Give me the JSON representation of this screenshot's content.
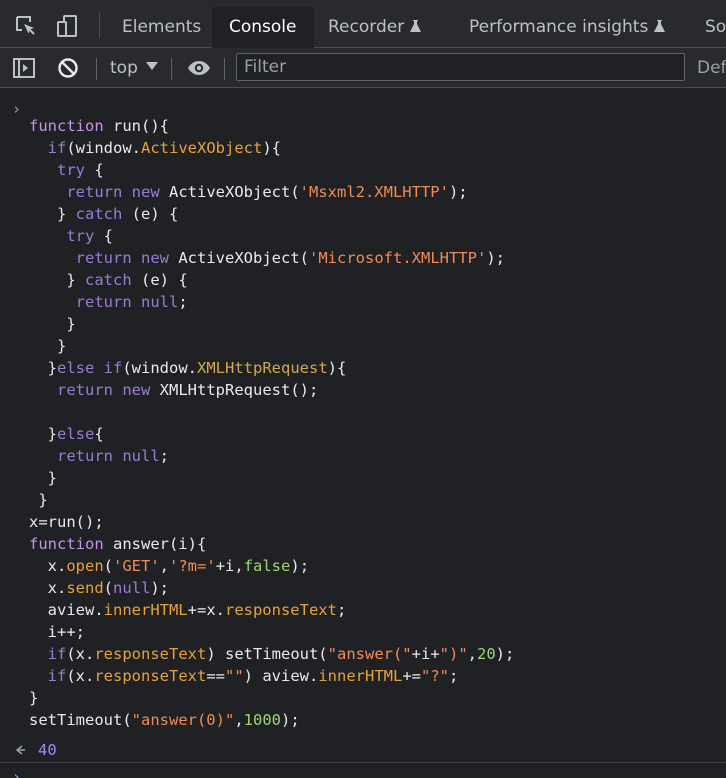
{
  "tabs": [
    {
      "label": "Elements",
      "active": false,
      "experimental": false
    },
    {
      "label": "Console",
      "active": true,
      "experimental": false
    },
    {
      "label": "Recorder",
      "active": false,
      "experimental": true
    },
    {
      "label": "Performance insights",
      "active": false,
      "experimental": true
    },
    {
      "label": "So",
      "active": false,
      "experimental": false
    }
  ],
  "toolbar": {
    "context_label": "top",
    "filter_placeholder": "Filter",
    "levels_label": "Def"
  },
  "icons": {
    "inspect": "inspect-element-icon",
    "device": "device-toolbar-icon",
    "sidebar": "show-sidebar-icon",
    "clear": "clear-console-icon",
    "eye": "live-expression-eye-icon",
    "flask": "experimental-flask-icon"
  },
  "console": {
    "code_lines": [
      [
        {
          "t": "function",
          "c": "k"
        },
        {
          "t": " run(){",
          "c": ""
        }
      ],
      [
        {
          "t": "  ",
          "c": ""
        },
        {
          "t": "if",
          "c": "kw"
        },
        {
          "t": "(window.",
          "c": ""
        },
        {
          "t": "ActiveXObject",
          "c": "p"
        },
        {
          "t": "){",
          "c": ""
        }
      ],
      [
        {
          "t": "   ",
          "c": ""
        },
        {
          "t": "try",
          "c": "kw"
        },
        {
          "t": " {",
          "c": ""
        }
      ],
      [
        {
          "t": "    ",
          "c": ""
        },
        {
          "t": "return",
          "c": "kw"
        },
        {
          "t": " ",
          "c": ""
        },
        {
          "t": "new",
          "c": "kw"
        },
        {
          "t": " ActiveXObject(",
          "c": ""
        },
        {
          "t": "'Msxml2.XMLHTTP'",
          "c": "s"
        },
        {
          "t": ");",
          "c": ""
        }
      ],
      [
        {
          "t": "   } ",
          "c": ""
        },
        {
          "t": "catch",
          "c": "kw"
        },
        {
          "t": " (e) {",
          "c": ""
        }
      ],
      [
        {
          "t": "    ",
          "c": ""
        },
        {
          "t": "try",
          "c": "kw"
        },
        {
          "t": " {",
          "c": ""
        }
      ],
      [
        {
          "t": "     ",
          "c": ""
        },
        {
          "t": "return",
          "c": "kw"
        },
        {
          "t": " ",
          "c": ""
        },
        {
          "t": "new",
          "c": "kw"
        },
        {
          "t": " ActiveXObject(",
          "c": ""
        },
        {
          "t": "'Microsoft.XMLHTTP'",
          "c": "s"
        },
        {
          "t": ");",
          "c": ""
        }
      ],
      [
        {
          "t": "    } ",
          "c": ""
        },
        {
          "t": "catch",
          "c": "kw"
        },
        {
          "t": " (e) {",
          "c": ""
        }
      ],
      [
        {
          "t": "     ",
          "c": ""
        },
        {
          "t": "return",
          "c": "kw"
        },
        {
          "t": " ",
          "c": ""
        },
        {
          "t": "null",
          "c": "kw"
        },
        {
          "t": ";",
          "c": ""
        }
      ],
      [
        {
          "t": "    }",
          "c": ""
        }
      ],
      [
        {
          "t": "   }",
          "c": ""
        }
      ],
      [
        {
          "t": "  }",
          "c": ""
        },
        {
          "t": "else",
          "c": "kw"
        },
        {
          "t": " ",
          "c": ""
        },
        {
          "t": "if",
          "c": "kw"
        },
        {
          "t": "(window.",
          "c": ""
        },
        {
          "t": "XMLHttpRequest",
          "c": "fn"
        },
        {
          "t": "){",
          "c": ""
        }
      ],
      [
        {
          "t": "   ",
          "c": ""
        },
        {
          "t": "return",
          "c": "kw"
        },
        {
          "t": " ",
          "c": ""
        },
        {
          "t": "new",
          "c": "kw"
        },
        {
          "t": " XMLHttpRequest();",
          "c": ""
        }
      ],
      [
        {
          "t": "",
          "c": ""
        }
      ],
      [
        {
          "t": "  }",
          "c": ""
        },
        {
          "t": "else",
          "c": "kw"
        },
        {
          "t": "{",
          "c": ""
        }
      ],
      [
        {
          "t": "   ",
          "c": ""
        },
        {
          "t": "return",
          "c": "kw"
        },
        {
          "t": " ",
          "c": ""
        },
        {
          "t": "null",
          "c": "kw"
        },
        {
          "t": ";",
          "c": ""
        }
      ],
      [
        {
          "t": "  }",
          "c": ""
        }
      ],
      [
        {
          "t": " }",
          "c": ""
        }
      ],
      [
        {
          "t": "x=run();",
          "c": ""
        }
      ],
      [
        {
          "t": "function",
          "c": "k"
        },
        {
          "t": " answer(i){",
          "c": ""
        }
      ],
      [
        {
          "t": "  x.",
          "c": ""
        },
        {
          "t": "open",
          "c": "p"
        },
        {
          "t": "(",
          "c": ""
        },
        {
          "t": "'GET'",
          "c": "s"
        },
        {
          "t": ",",
          "c": ""
        },
        {
          "t": "'?m='",
          "c": "s"
        },
        {
          "t": "+i,",
          "c": ""
        },
        {
          "t": "false",
          "c": "n"
        },
        {
          "t": ");",
          "c": ""
        }
      ],
      [
        {
          "t": "  x.",
          "c": ""
        },
        {
          "t": "send",
          "c": "p"
        },
        {
          "t": "(",
          "c": ""
        },
        {
          "t": "null",
          "c": "kw"
        },
        {
          "t": ");",
          "c": ""
        }
      ],
      [
        {
          "t": "  aview.",
          "c": ""
        },
        {
          "t": "innerHTML",
          "c": "p"
        },
        {
          "t": "+=x.",
          "c": ""
        },
        {
          "t": "responseText",
          "c": "p"
        },
        {
          "t": ";",
          "c": ""
        }
      ],
      [
        {
          "t": "  i++;",
          "c": ""
        }
      ],
      [
        {
          "t": "  ",
          "c": ""
        },
        {
          "t": "if",
          "c": "kw"
        },
        {
          "t": "(x.",
          "c": ""
        },
        {
          "t": "responseText",
          "c": "p"
        },
        {
          "t": ") setTimeout(",
          "c": ""
        },
        {
          "t": "\"answer(\"",
          "c": "s"
        },
        {
          "t": "+i+",
          "c": ""
        },
        {
          "t": "\")\"",
          "c": "s"
        },
        {
          "t": ",",
          "c": ""
        },
        {
          "t": "20",
          "c": "n"
        },
        {
          "t": ");",
          "c": ""
        }
      ],
      [
        {
          "t": "  ",
          "c": ""
        },
        {
          "t": "if",
          "c": "kw"
        },
        {
          "t": "(x.",
          "c": ""
        },
        {
          "t": "responseText",
          "c": "p"
        },
        {
          "t": "==",
          "c": ""
        },
        {
          "t": "\"\"",
          "c": "s"
        },
        {
          "t": ") aview.",
          "c": ""
        },
        {
          "t": "innerHTML",
          "c": "p"
        },
        {
          "t": "+=",
          "c": ""
        },
        {
          "t": "\"?\"",
          "c": "s"
        },
        {
          "t": ";",
          "c": ""
        }
      ],
      [
        {
          "t": "}",
          "c": ""
        }
      ],
      [
        {
          "t": "setTimeout(",
          "c": ""
        },
        {
          "t": "\"answer(0)\"",
          "c": "s"
        },
        {
          "t": ",",
          "c": ""
        },
        {
          "t": "1000",
          "c": "n"
        },
        {
          "t": ");",
          "c": ""
        }
      ]
    ],
    "result_value": "40"
  },
  "colors": {
    "background": "#202124",
    "toolbar": "#292a2d",
    "keyword": "#c792ea",
    "property": "#e8a23a",
    "string": "#f28b54",
    "number": "#9bd873",
    "result": "#9e8cff"
  }
}
